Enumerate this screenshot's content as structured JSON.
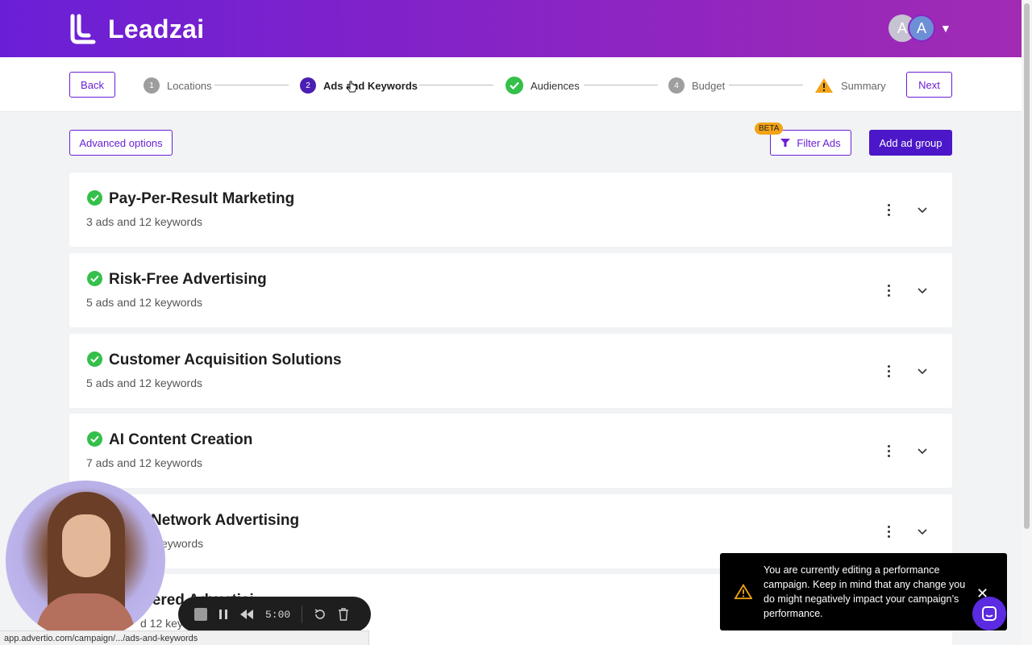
{
  "header": {
    "brand": "Leadzai",
    "avatars": [
      "A",
      "A"
    ],
    "avatar_caret": "▼"
  },
  "stepper": {
    "back_label": "Back",
    "next_label": "Next",
    "steps": [
      {
        "number": "1",
        "label": "Locations",
        "state": "pending"
      },
      {
        "number": "2",
        "label": "Ads and Keywords",
        "state": "active"
      },
      {
        "number": "",
        "label": "Audiences",
        "state": "complete"
      },
      {
        "number": "4",
        "label": "Budget",
        "state": "pending"
      },
      {
        "number": "",
        "label": "Summary",
        "state": "warning"
      }
    ]
  },
  "toolbar": {
    "advanced_label": "Advanced options",
    "beta_badge": "BETA",
    "filter_label": "Filter Ads",
    "add_group_label": "Add ad group"
  },
  "ad_groups": [
    {
      "title": "Pay-Per-Result Marketing",
      "summary": "3 ads and 12 keywords"
    },
    {
      "title": "Risk-Free Advertising",
      "summary": "5 ads and 12 keywords"
    },
    {
      "title": "Customer Acquisition Solutions",
      "summary": "5 ads and 12 keywords"
    },
    {
      "title": "AI Content Creation",
      "summary": "7 ads and 12 keywords"
    },
    {
      "title": "Network Advertising",
      "summary": "eywords"
    },
    {
      "title": "wered Advertisi",
      "summary": "d 12 keyw"
    }
  ],
  "toast": {
    "message": "You are currently editing a performance campaign. Keep in mind that any change you do might negatively impact your campaign’s performance.",
    "close_glyph": "✕"
  },
  "recorder": {
    "time": "5:00"
  },
  "status_url": "app.advertio.com/campaign/.../ads-and-keywords",
  "colors": {
    "brand_purple": "#6a1fd6",
    "primary_button": "#4b17c8",
    "success_green": "#34c04a",
    "warning_orange": "#f2a416"
  }
}
